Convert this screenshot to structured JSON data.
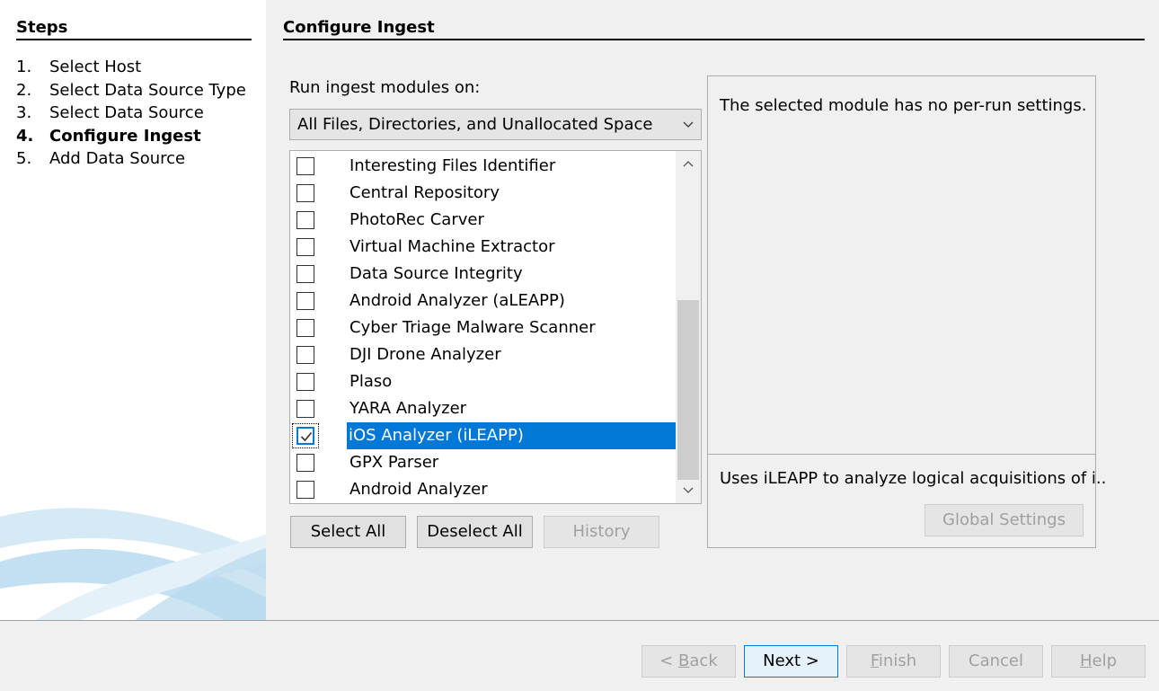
{
  "steps": {
    "title": "Steps",
    "items": [
      {
        "num": "1.",
        "label": "Select Host"
      },
      {
        "num": "2.",
        "label": "Select Data Source Type"
      },
      {
        "num": "3.",
        "label": "Select Data Source"
      },
      {
        "num": "4.",
        "label": "Configure Ingest"
      },
      {
        "num": "5.",
        "label": "Add Data Source"
      }
    ]
  },
  "main": {
    "title": "Configure Ingest",
    "run_label": "Run ingest modules on:",
    "combo_value": "All Files, Directories, and Unallocated Space",
    "modules": [
      {
        "label": "Interesting Files Identifier",
        "checked": false
      },
      {
        "label": "Central Repository",
        "checked": false
      },
      {
        "label": "PhotoRec Carver",
        "checked": false
      },
      {
        "label": "Virtual Machine Extractor",
        "checked": false
      },
      {
        "label": "Data Source Integrity",
        "checked": false
      },
      {
        "label": "Android Analyzer (aLEAPP)",
        "checked": false
      },
      {
        "label": "Cyber Triage Malware Scanner",
        "checked": false
      },
      {
        "label": "DJI Drone Analyzer",
        "checked": false
      },
      {
        "label": "Plaso",
        "checked": false
      },
      {
        "label": "YARA Analyzer",
        "checked": false
      },
      {
        "label": "iOS Analyzer (iLEAPP)",
        "checked": true
      },
      {
        "label": "GPX Parser",
        "checked": false
      },
      {
        "label": "Android Analyzer",
        "checked": false
      }
    ],
    "select_all": "Select All",
    "deselect_all": "Deselect All",
    "history": "History",
    "settings_msg": "The selected module has no per-run settings.",
    "description": "Uses iLEAPP to analyze logical acquisitions of i..",
    "global_settings": "Global Settings"
  },
  "footer": {
    "back_prefix": "< ",
    "back_key": "B",
    "back_rest": "ack",
    "next": "Next >",
    "finish_key": "F",
    "finish_rest": "inish",
    "cancel": "Cancel",
    "help_key": "H",
    "help_rest": "elp"
  },
  "colors": {
    "selection": "#0078d7",
    "dialog_bg": "#f0f0f0"
  }
}
